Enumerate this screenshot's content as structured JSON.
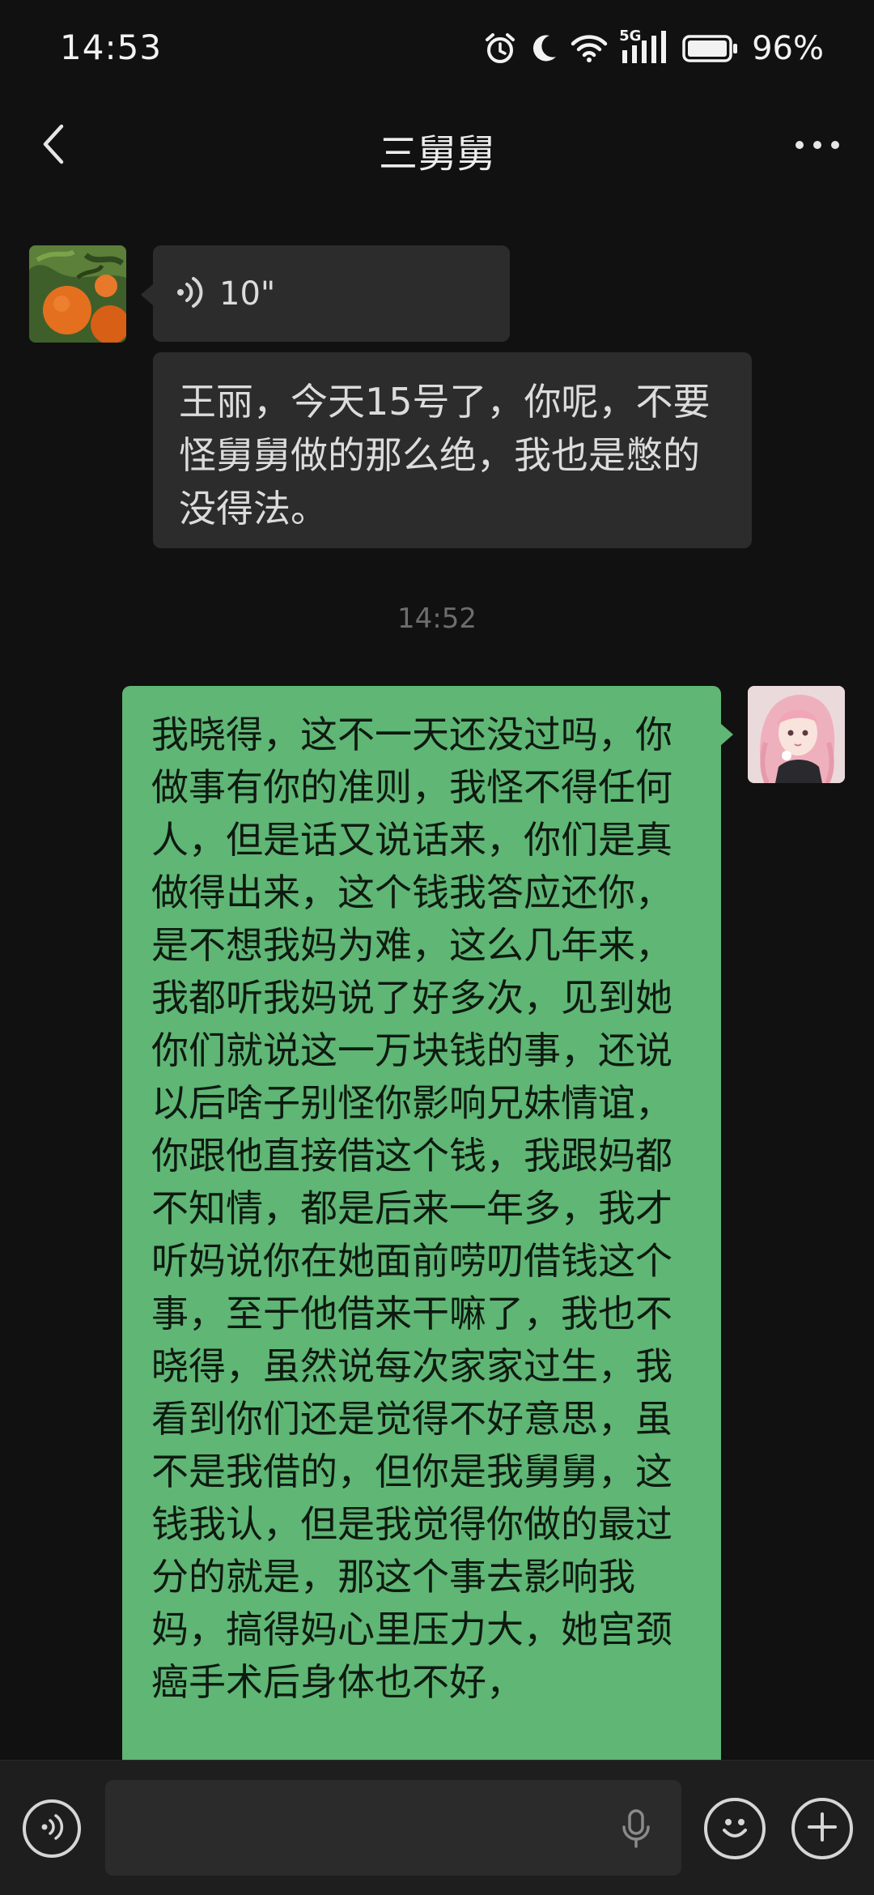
{
  "status_bar": {
    "time": "14:53",
    "network": "5G",
    "battery_percent": "96%",
    "icons": [
      "alarm-icon",
      "moon-icon",
      "wifi-icon",
      "signal-icon",
      "battery-icon"
    ]
  },
  "header": {
    "title": "三舅舅",
    "back_icon": "chevron-left-icon",
    "more_icon": "more-dots-icon"
  },
  "messages": [
    {
      "direction": "incoming",
      "type": "voice",
      "duration": "10\""
    },
    {
      "direction": "incoming",
      "type": "text",
      "text": "王丽，今天15号了，你呢，不要怪舅舅做的那么绝，我也是憋的没得法。"
    },
    {
      "type": "timestamp",
      "text": "14:52"
    },
    {
      "direction": "outgoing",
      "type": "text",
      "text": "我晓得，这不一天还没过吗，你做事有你的准则，我怪不得任何人，但是话又说话来，你们是真做得出来，这个钱我答应还你，是不想我妈为难，这么几年来，我都听我妈说了好多次，见到她你们就说这一万块钱的事，还说以后啥子别怪你影响兄妹情谊，你跟他直接借这个钱，我跟妈都不知情，都是后来一年多，我才听妈说你在她面前唠叨借钱这个事，至于他借来干嘛了，我也不晓得，虽然说每次家家过生，我看到你们还是觉得不好意思，虽不是我借的，但你是我舅舅，这钱我认，但是我觉得你做的最过分的就是，那这个事去影响我妈，搞得妈心里压力大，她宫颈癌手术后身体也不好，"
    }
  ],
  "input_bar": {
    "voice_toggle_icon": "voice-wave-icon",
    "mic_icon": "microphone-icon",
    "emoji_icon": "smiley-icon",
    "plus_icon": "plus-icon"
  },
  "colors": {
    "background": "#111111",
    "incoming_bubble": "#2c2c2c",
    "outgoing_bubble": "#5fb675",
    "input_bar": "#1e1e1e"
  }
}
